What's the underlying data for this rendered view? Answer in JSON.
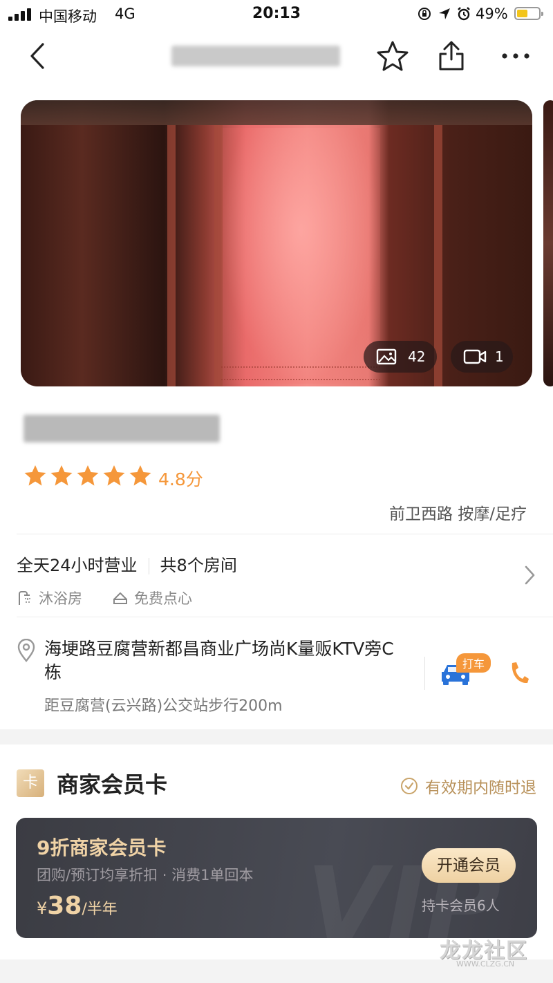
{
  "status_bar": {
    "carrier": "中国移动",
    "network": "4G",
    "time": "20:13",
    "battery": "49%",
    "battery_level": 0.49
  },
  "header": {
    "title_blurred": true,
    "icons": [
      "back-icon",
      "star-outline-icon",
      "share-icon",
      "more-icon"
    ]
  },
  "gallery": {
    "photo_count": "42",
    "video_count": "1"
  },
  "shop": {
    "name_blurred": true,
    "rating_stars": 5,
    "score": "4.8分",
    "meta": "前卫西路 按摩/足疗",
    "hours": "全天24小时营业",
    "rooms": "共8个房间",
    "tags": [
      "沐浴房",
      "免费点心"
    ],
    "address": "海埂路豆腐营新都昌商业广场尚K量贩KTV旁C栋",
    "distance": "距豆腐营(云兴路)公交站步行200m",
    "taxi_label": "打车"
  },
  "member": {
    "section_title": "商家会员卡",
    "card_icon_label": "卡",
    "refund_note": "有效期内随时退",
    "card_title": "9折商家会员卡",
    "card_subtitle": "团购/预订均享折扣 · 消费1单回本",
    "price_currency": "¥",
    "price": "38",
    "price_unit": "/半年",
    "button_label": "开通会员",
    "members_count": "持卡会员6人",
    "watermark": "VIP"
  },
  "watermark": {
    "text": "龙龙社区",
    "url": "WWW.CLZG.CN"
  },
  "colors": {
    "accent": "#f5973a",
    "gold": "#f0d3a6",
    "taxi_blue": "#2a73d9"
  }
}
